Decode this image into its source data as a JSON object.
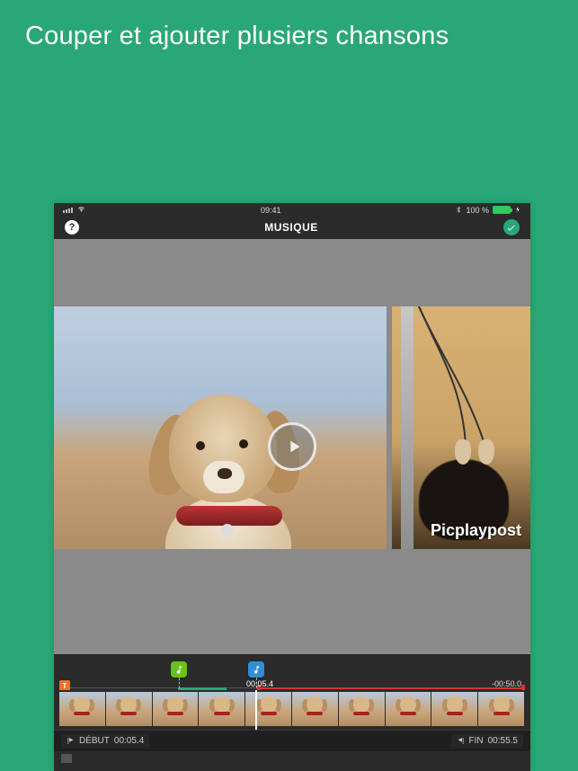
{
  "headline": "Couper et ajouter plusiers chansons",
  "statusbar": {
    "time": "09:41",
    "battery_text": "100 %",
    "bluetooth_icon": "bluetooth-icon",
    "wifi_icon": "wifi-icon"
  },
  "appbar": {
    "title": "MUSIQUE",
    "help_label": "?",
    "confirm_icon": "check-icon"
  },
  "canvas": {
    "watermark": "Picplaypost",
    "play_icon": "play-icon"
  },
  "timeline": {
    "marker_label": "T",
    "music_chip_green": "music-note-icon",
    "music_chip_blue": "music-note-icon",
    "playhead_time": "00:05.4",
    "end_time": "-00:50.0"
  },
  "thumbnails": {
    "count": 10
  },
  "trimbar": {
    "start": {
      "label": "DÉBUT",
      "value": "00:05.4"
    },
    "end": {
      "label": "FIN",
      "value": "00:55.5"
    }
  }
}
